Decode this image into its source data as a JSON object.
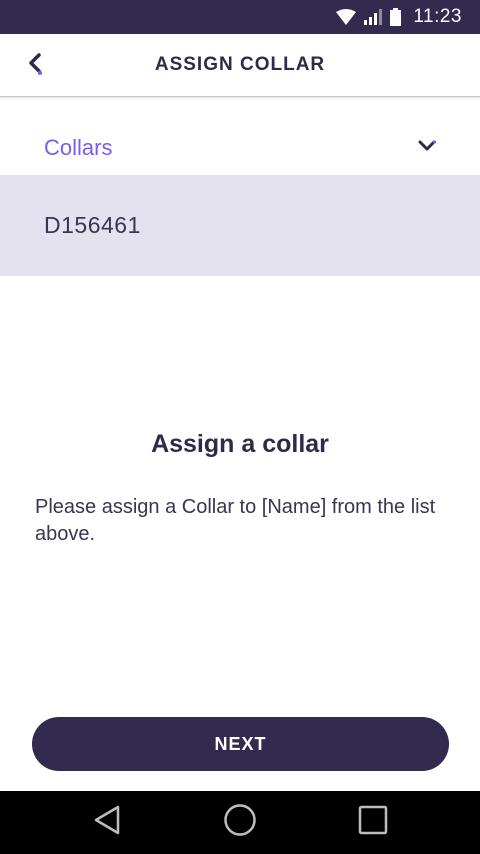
{
  "status_bar": {
    "time": "11:23",
    "icons": [
      "wifi-icon",
      "cell-signal-icon",
      "battery-icon"
    ]
  },
  "app_bar": {
    "title": "ASSIGN COLLAR",
    "back_icon": "back-chevron-icon"
  },
  "dropdown": {
    "label": "Collars",
    "icon": "chevron-down-icon",
    "items": [
      {
        "label": "D156461"
      }
    ]
  },
  "empty_state": {
    "title": "Assign a collar",
    "message": "Please assign a Collar to [Name] from the list above."
  },
  "actions": {
    "next_label": "NEXT"
  },
  "nav_bar": {
    "icons": [
      "back-triangle-icon",
      "home-circle-icon",
      "recents-square-icon"
    ]
  },
  "colors": {
    "primary_dark": "#332b4f",
    "accent_purple": "#7b5cf0",
    "selected_row": "#e4e2ee"
  }
}
